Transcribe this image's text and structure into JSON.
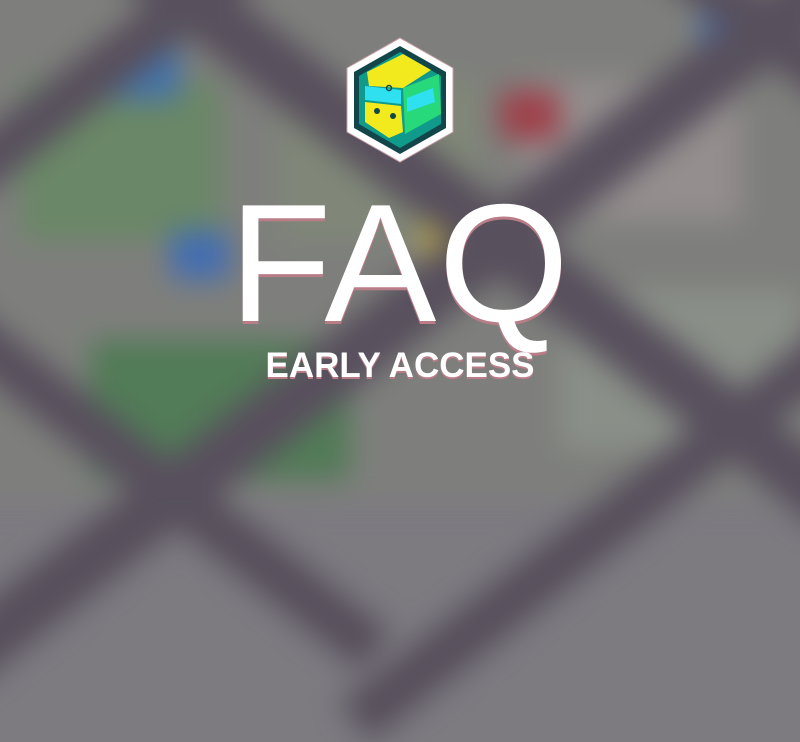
{
  "title": "FAQ",
  "subtitle": "EARLY ACCESS",
  "logo": {
    "icon": "train-front-icon",
    "colors": {
      "yellow": "#f2ea1c",
      "cyan": "#2ee0f0",
      "green": "#27d97a",
      "teal": "#0f9a8c",
      "outline": "#12464a"
    }
  },
  "background": "blurred-city-map"
}
